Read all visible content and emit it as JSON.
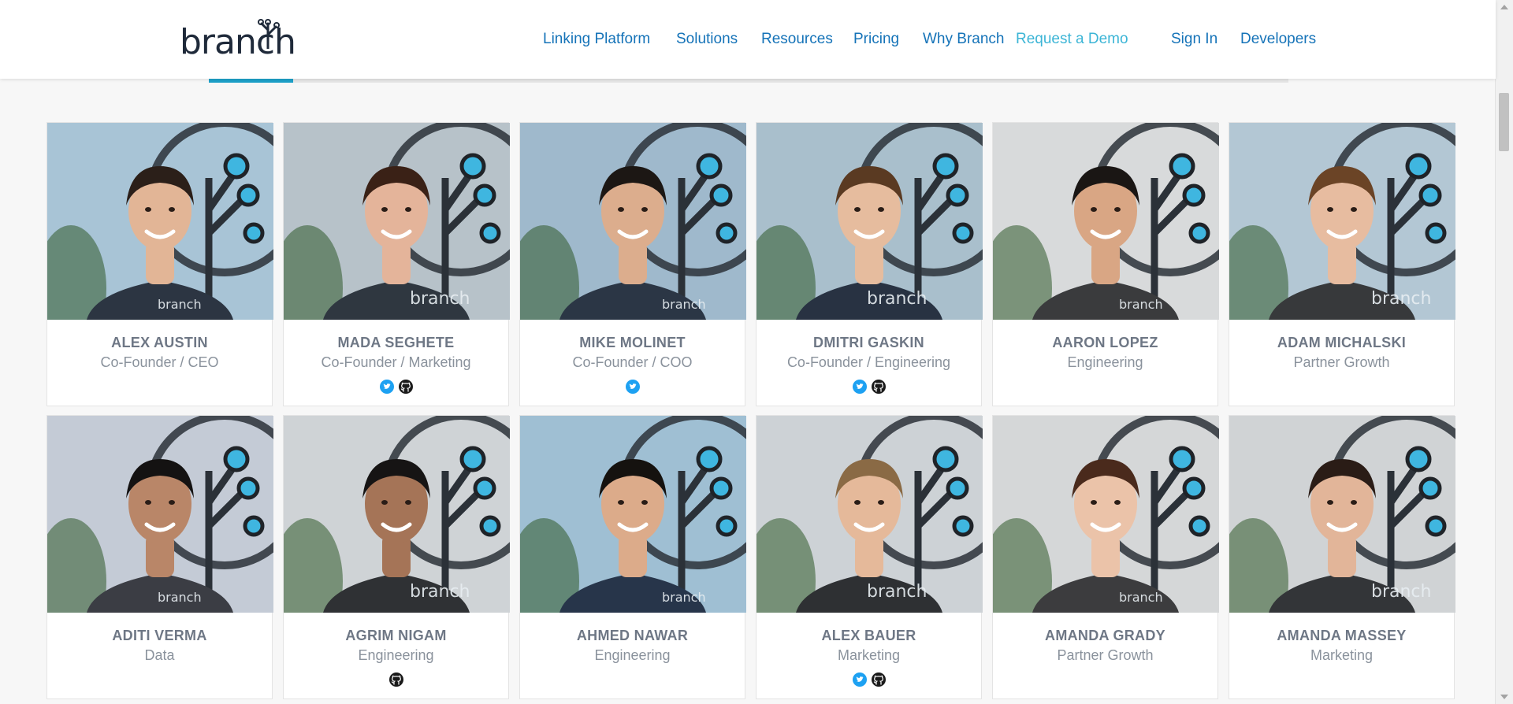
{
  "header": {
    "logo_text": "branch",
    "nav": [
      {
        "label": "Linking Platform",
        "key": "linking-platform"
      },
      {
        "label": "Solutions",
        "key": "solutions"
      },
      {
        "label": "Resources",
        "key": "resources"
      },
      {
        "label": "Pricing",
        "key": "pricing"
      },
      {
        "label": "Why Branch",
        "key": "why-branch"
      },
      {
        "label": "Request a Demo",
        "key": "request-demo"
      },
      {
        "label": "Sign In",
        "key": "sign-in"
      },
      {
        "label": "Developers",
        "key": "developers"
      }
    ]
  },
  "colors": {
    "nav_link": "#1573b8",
    "accent": "#1da1c9",
    "twitter": "#1da1f2",
    "github": "#1a1a1a"
  },
  "team": [
    {
      "name": "ALEX AUSTIN",
      "role": "Co-Founder / CEO",
      "socials": []
    },
    {
      "name": "MADA SEGHETE",
      "role": "Co-Founder / Marketing",
      "socials": [
        "twitter",
        "github"
      ]
    },
    {
      "name": "MIKE MOLINET",
      "role": "Co-Founder / COO",
      "socials": [
        "twitter"
      ]
    },
    {
      "name": "DMITRI GASKIN",
      "role": "Co-Founder / Engineering",
      "socials": [
        "twitter",
        "github"
      ]
    },
    {
      "name": "AARON LOPEZ",
      "role": "Engineering",
      "socials": []
    },
    {
      "name": "ADAM MICHALSKI",
      "role": "Partner Growth",
      "socials": []
    },
    {
      "name": "ADITI VERMA",
      "role": "Data",
      "socials": []
    },
    {
      "name": "AGRIM NIGAM",
      "role": "Engineering",
      "socials": [
        "github"
      ]
    },
    {
      "name": "AHMED NAWAR",
      "role": "Engineering",
      "socials": []
    },
    {
      "name": "ALEX BAUER",
      "role": "Marketing",
      "socials": [
        "twitter",
        "github"
      ]
    },
    {
      "name": "AMANDA GRADY",
      "role": "Partner Growth",
      "socials": []
    },
    {
      "name": "AMANDA MASSEY",
      "role": "Marketing",
      "socials": []
    }
  ]
}
